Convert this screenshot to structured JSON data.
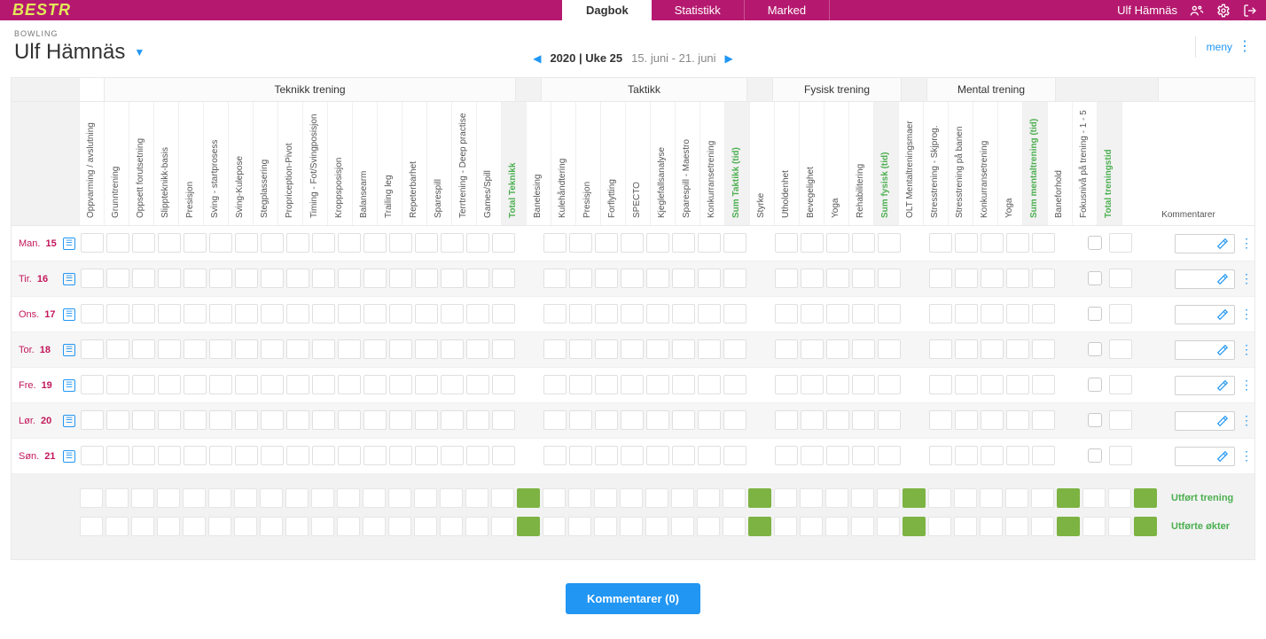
{
  "topbar": {
    "logo": "BESTR",
    "tabs": [
      {
        "label": "Dagbok",
        "active": true
      },
      {
        "label": "Statistikk",
        "active": false
      },
      {
        "label": "Marked",
        "active": false
      }
    ],
    "user": "Ulf Hämnäs"
  },
  "header": {
    "sport": "BOWLING",
    "athlete": "Ulf Hämnäs",
    "week_bold": "2020 | Uke 25",
    "week_range": "15. juni - 21. juni",
    "meny": "meny"
  },
  "groups": [
    {
      "label": "Teknikk trening",
      "span": 16
    },
    {
      "label": "Taktikk",
      "span": 8
    },
    {
      "label": "Fysisk trening",
      "span": 5
    },
    {
      "label": "Mental trening",
      "span": 5
    }
  ],
  "columns": [
    {
      "label": "Oppvarming / avslutning",
      "type": "plain",
      "pregroup": true
    },
    {
      "label": "Grunntrening",
      "type": "plain"
    },
    {
      "label": "Oppsett forutsetning",
      "type": "plain"
    },
    {
      "label": "Slippteknikk-basis",
      "type": "plain"
    },
    {
      "label": "Presisjon",
      "type": "plain"
    },
    {
      "label": "Sving - startprosess",
      "type": "plain"
    },
    {
      "label": "Sving-Kulepose",
      "type": "plain"
    },
    {
      "label": "Stegplassering",
      "type": "plain"
    },
    {
      "label": "Propriception-Pivot",
      "type": "plain"
    },
    {
      "label": "Timing - Fot/Svingposisjon",
      "type": "plain"
    },
    {
      "label": "Kroppsposisjon",
      "type": "plain"
    },
    {
      "label": "Balansearm",
      "type": "plain"
    },
    {
      "label": "Trailing leg",
      "type": "plain"
    },
    {
      "label": "Repeterbarhet",
      "type": "plain"
    },
    {
      "label": "Sparespill",
      "type": "plain"
    },
    {
      "label": "Terrtrening - Deep practise",
      "type": "plain"
    },
    {
      "label": "Games/Spill",
      "type": "plain"
    },
    {
      "label": "Total Teknikk",
      "type": "sum"
    },
    {
      "label": "Banelesing",
      "type": "plain"
    },
    {
      "label": "Kulehåndtering",
      "type": "plain"
    },
    {
      "label": "Presisjon",
      "type": "plain"
    },
    {
      "label": "Forflytting",
      "type": "plain"
    },
    {
      "label": "SPECTO",
      "type": "plain"
    },
    {
      "label": "Kjeglefallsanalyse",
      "type": "plain"
    },
    {
      "label": "Sparespill - Maestro",
      "type": "plain"
    },
    {
      "label": "Konkurransetrening",
      "type": "plain"
    },
    {
      "label": "Sum Taktikk (tid)",
      "type": "sum"
    },
    {
      "label": "Styrke",
      "type": "plain"
    },
    {
      "label": "Utholdenhet",
      "type": "plain"
    },
    {
      "label": "Bevegelighet",
      "type": "plain"
    },
    {
      "label": "Yoga",
      "type": "plain"
    },
    {
      "label": "Rehabilitering",
      "type": "plain"
    },
    {
      "label": "Sum fysisk (tid)",
      "type": "sum"
    },
    {
      "label": "OLT Mentaltreningsmaer",
      "type": "plain"
    },
    {
      "label": "Stresstrening - Skjprog.",
      "type": "plain"
    },
    {
      "label": "Stresstrening på banen",
      "type": "plain"
    },
    {
      "label": "Konkurransetrening",
      "type": "plain"
    },
    {
      "label": "Yoga",
      "type": "plain"
    },
    {
      "label": "Sum mentaltrening (tid)",
      "type": "sum"
    },
    {
      "label": "Baneforhold",
      "type": "check"
    },
    {
      "label": "Fokusnivå på trening - 1 - 5",
      "type": "plain"
    },
    {
      "label": "Total treningstid",
      "type": "sum"
    }
  ],
  "komm_header": "Kommentarer",
  "days": [
    {
      "name": "Man.",
      "num": "15"
    },
    {
      "name": "Tir.",
      "num": "16"
    },
    {
      "name": "Ons.",
      "num": "17"
    },
    {
      "name": "Tor.",
      "num": "18"
    },
    {
      "name": "Fre.",
      "num": "19"
    },
    {
      "name": "Lør.",
      "num": "20"
    },
    {
      "name": "Søn.",
      "num": "21"
    }
  ],
  "summary_rows": [
    {
      "label": "Utført trening",
      "green_indices": [
        17,
        26,
        32,
        38,
        41
      ]
    },
    {
      "label": "Utførte økter",
      "green_indices": [
        17,
        26,
        32,
        38,
        41
      ]
    }
  ],
  "comments_btn": "Kommentarer (0)"
}
